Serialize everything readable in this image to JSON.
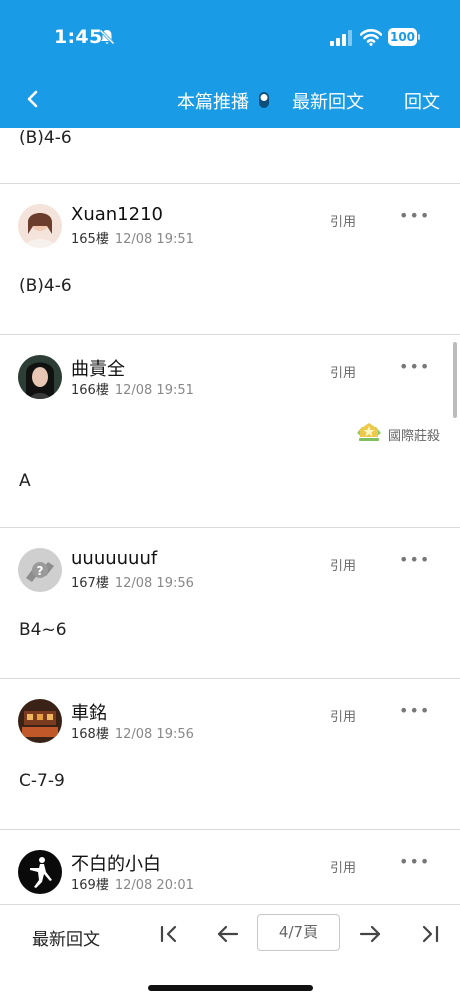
{
  "status_bar": {
    "time": "1:45",
    "battery": "100"
  },
  "nav": {
    "back_icon": "chevron-left-icon",
    "live_label": "本篇推播",
    "latest_label": "最新回文",
    "reply_label": "回文"
  },
  "colors": {
    "brand_blue": "#1a9be6",
    "divider": "#d9d9d9",
    "meta_gray": "#888888"
  },
  "cut_post": {
    "body": "(B)4-6"
  },
  "posts": [
    {
      "username": "Xuan1210",
      "floor": "165樓",
      "time": "12/08 19:51",
      "quote": "引用",
      "more": "•••",
      "body": "(B)4-6"
    },
    {
      "username": "曲責全",
      "floor": "166樓",
      "time": "12/08 19:51",
      "quote": "引用",
      "more": "•••",
      "badge": "國際莊殺",
      "body": "A"
    },
    {
      "username": "uuuuuuuf",
      "floor": "167樓",
      "time": "12/08 19:56",
      "quote": "引用",
      "more": "•••",
      "body": "B4~6"
    },
    {
      "username": "車銘",
      "floor": "168樓",
      "time": "12/08 19:56",
      "quote": "引用",
      "more": "•••",
      "body": "C-7-9"
    },
    {
      "username": "不白的小白",
      "floor": "169樓",
      "time": "12/08 20:01",
      "quote": "引用",
      "more": "•••"
    }
  ],
  "bottom_bar": {
    "latest_label": "最新回文",
    "page_indicator": "4/7頁"
  }
}
